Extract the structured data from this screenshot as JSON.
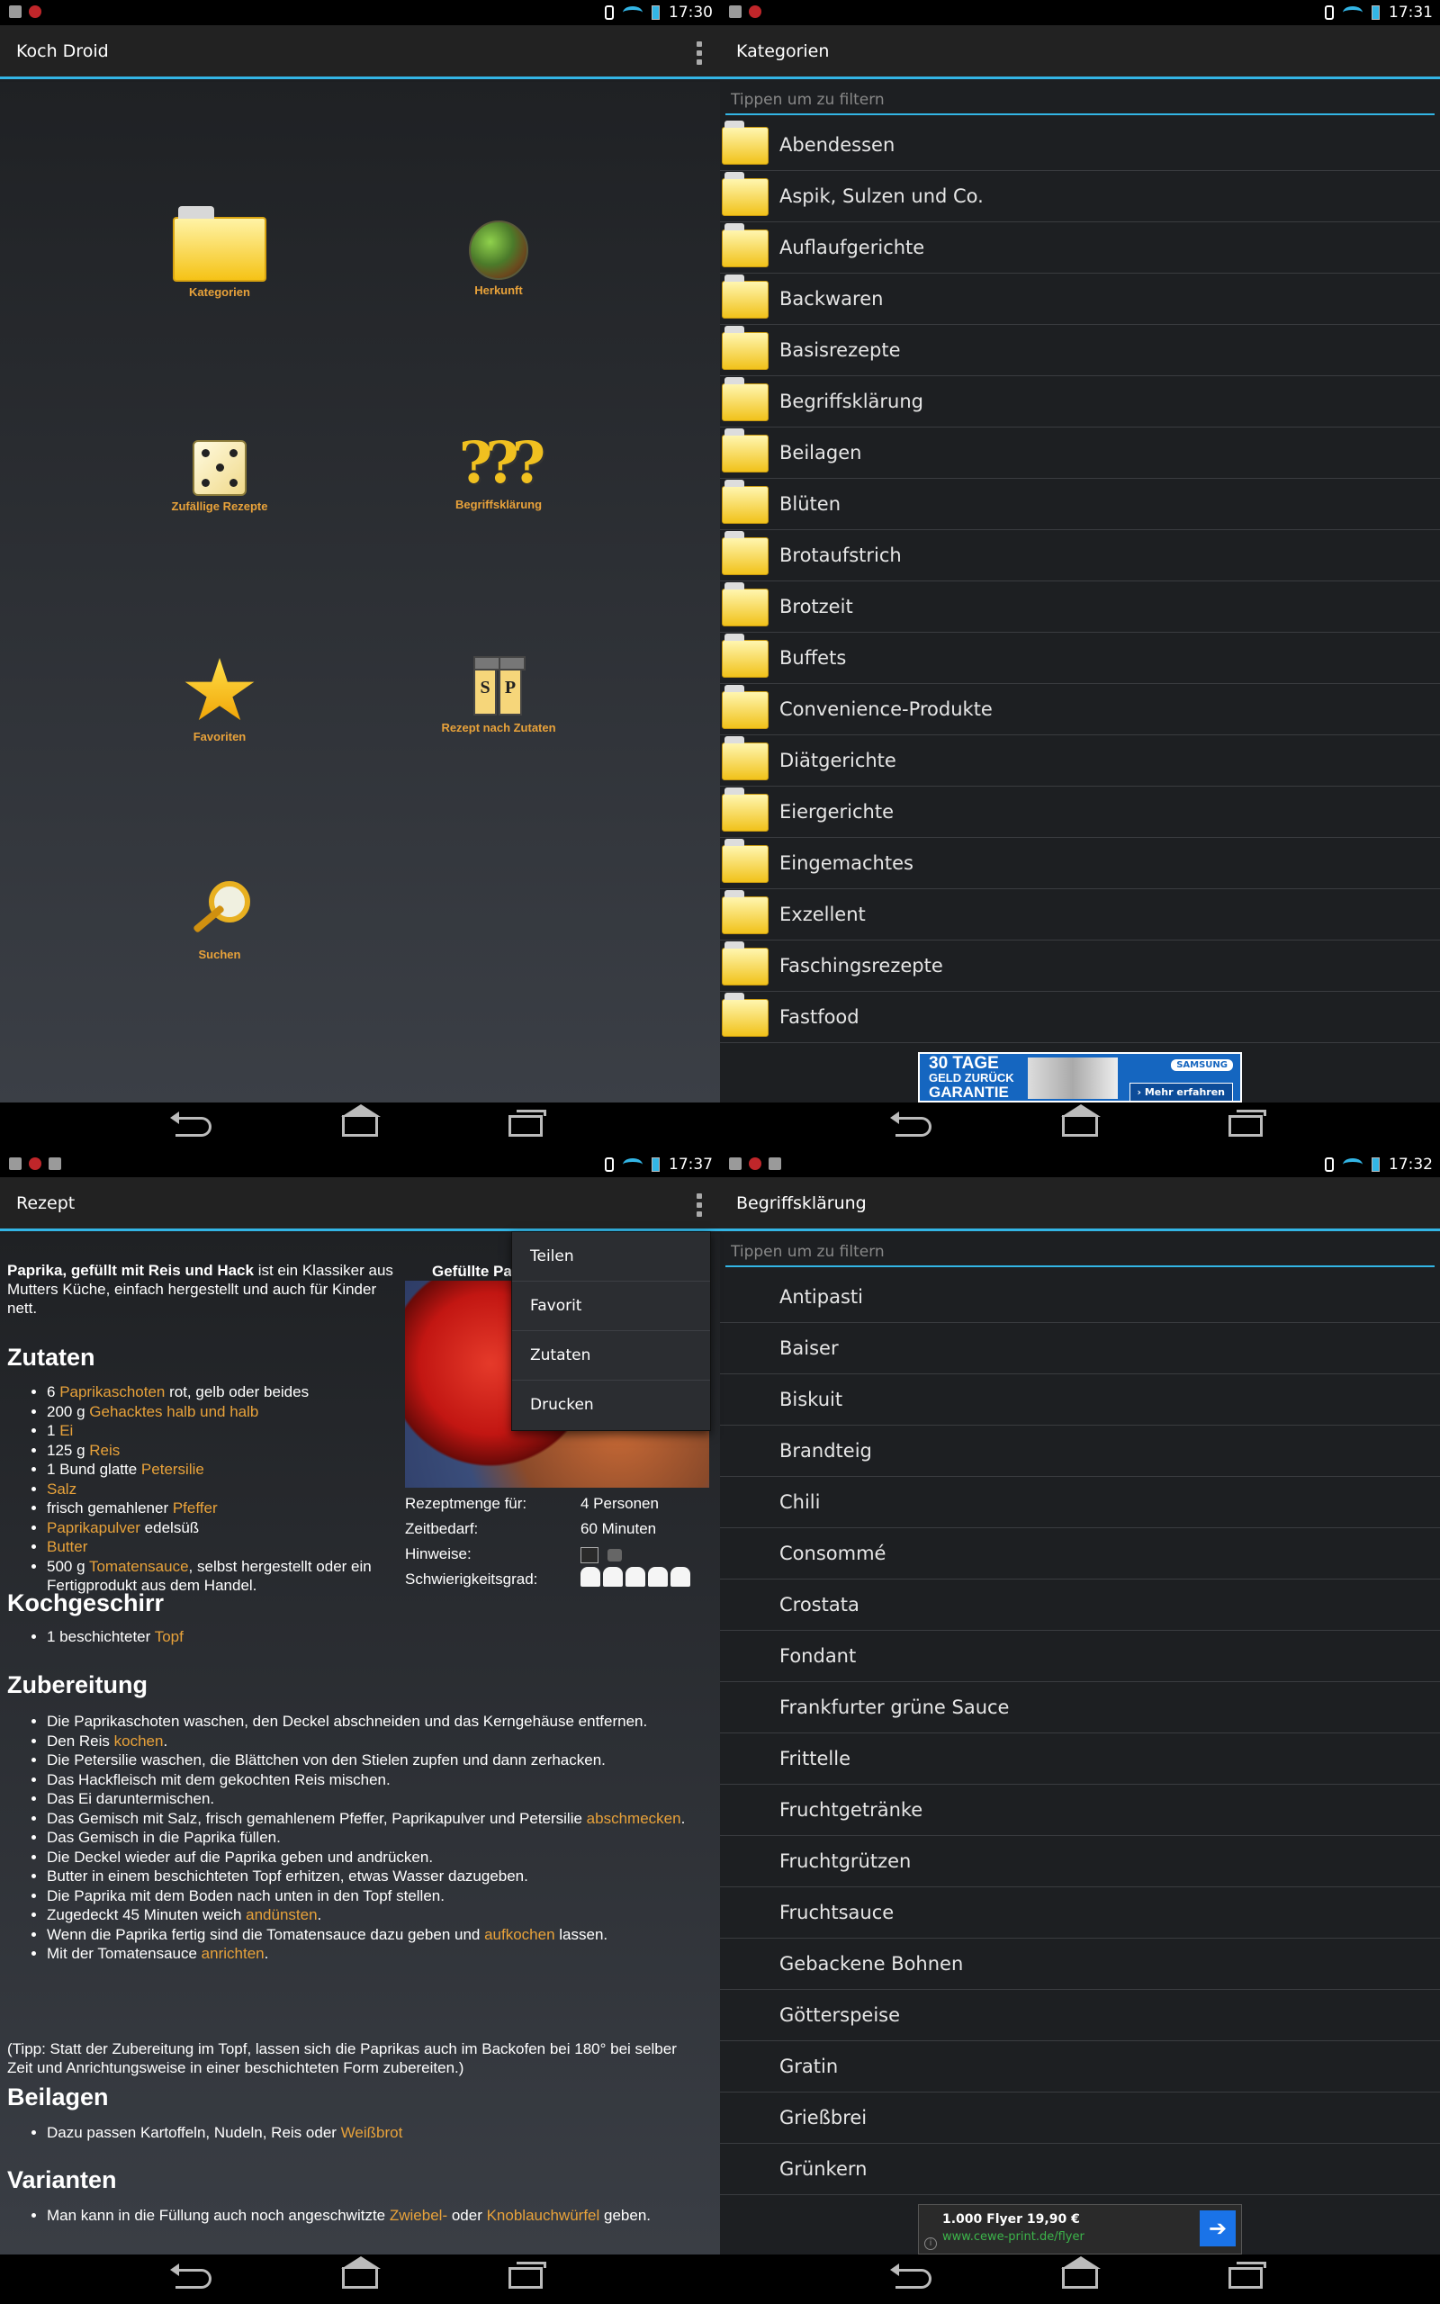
{
  "panel1": {
    "status_time": "17:30",
    "title": "Koch Droid",
    "tiles": [
      {
        "label": "Kategorien",
        "icon": "folder-icon"
      },
      {
        "label": "Herkunft",
        "icon": "globe-icon"
      },
      {
        "label": "Zufällige Rezepte",
        "icon": "dice-icon"
      },
      {
        "label": "Begriffsklärung",
        "icon": "question-marks-icon"
      },
      {
        "label": "Favoriten",
        "icon": "star-icon"
      },
      {
        "label": "Rezept nach Zutaten",
        "icon": "spice-shakers-icon"
      },
      {
        "label": "Suchen",
        "icon": "magnifier-icon"
      }
    ]
  },
  "panel2": {
    "status_time": "17:31",
    "title": "Kategorien",
    "filter_placeholder": "Tippen um zu filtern",
    "items": [
      "Abendessen",
      "Aspik, Sulzen und Co.",
      "Auflaufgerichte",
      "Backwaren",
      "Basisrezepte",
      "Begriffsklärung",
      "Beilagen",
      "Blüten",
      "Brotaufstrich",
      "Brotzeit",
      "Buffets",
      "Convenience-Produkte",
      "Diätgerichte",
      "Eiergerichte",
      "Eingemachtes",
      "Exzellent",
      "Faschingsrezepte",
      "Fastfood"
    ],
    "ad": {
      "line1": "30 TAGE",
      "line2": "GELD ZURÜCK",
      "line3": "GARANTIE",
      "brand": "SAMSUNG",
      "button": "› Mehr erfahren"
    }
  },
  "panel3": {
    "status_time": "17:37",
    "title": "Rezept",
    "intro_bold": "Paprika, gefüllt mit Reis und Hack",
    "intro_rest": " ist ein Klassiker aus Mutters Küche, einfach hergestellt und auch für Kinder nett.",
    "image_caption": "Gefüllte Pa",
    "meta": [
      {
        "key": "Rezeptmenge für:",
        "value": "4 Personen"
      },
      {
        "key": "Zeitbedarf:",
        "value": "60 Minuten"
      },
      {
        "key": "Hinweise:",
        "value": ""
      },
      {
        "key": "Schwierigkeitsgrad:",
        "value": ""
      }
    ],
    "headings": {
      "zutaten": "Zutaten",
      "kochgeschirr": "Kochgeschirr",
      "zubereitung": "Zubereitung",
      "beilagen": "Beilagen",
      "varianten": "Varianten"
    },
    "zutaten": [
      {
        "pre": "6 ",
        "link": "Paprikaschoten",
        "post": " rot, gelb oder beides"
      },
      {
        "pre": "200 g ",
        "link": "Gehacktes halb und halb",
        "post": ""
      },
      {
        "pre": "1 ",
        "link": "Ei",
        "post": ""
      },
      {
        "pre": "125 g ",
        "link": "Reis",
        "post": ""
      },
      {
        "pre": "1 Bund glatte ",
        "link": "Petersilie",
        "post": ""
      },
      {
        "pre": "",
        "link": "Salz",
        "post": ""
      },
      {
        "pre": "frisch gemahlener ",
        "link": "Pfeffer",
        "post": ""
      },
      {
        "pre": "",
        "link": "Paprikapulver",
        "post": " edelsüß"
      },
      {
        "pre": "",
        "link": "Butter",
        "post": ""
      },
      {
        "pre": "500 g ",
        "link": "Tomatensauce",
        "post": ", selbst hergestellt oder ein Fertigprodukt aus dem Handel."
      }
    ],
    "kochgeschirr": [
      {
        "pre": "1 beschichteter ",
        "link": "Topf",
        "post": ""
      }
    ],
    "zubereitung": [
      {
        "pre": "Die Paprikaschoten waschen, den Deckel abschneiden und das Kerngehäuse entfernen.",
        "link": "",
        "post": ""
      },
      {
        "pre": "Den Reis ",
        "link": "kochen",
        "post": "."
      },
      {
        "pre": "Die Petersilie waschen, die Blättchen von den Stielen zupfen und dann zerhacken.",
        "link": "",
        "post": ""
      },
      {
        "pre": "Das Hackfleisch mit dem gekochten Reis mischen.",
        "link": "",
        "post": ""
      },
      {
        "pre": "Das Ei daruntermischen.",
        "link": "",
        "post": ""
      },
      {
        "pre": "Das Gemisch mit Salz, frisch gemahlenem Pfeffer, Paprikapulver und Petersilie ",
        "link": "abschmecken",
        "post": "."
      },
      {
        "pre": "Das Gemisch in die Paprika füllen.",
        "link": "",
        "post": ""
      },
      {
        "pre": "Die Deckel wieder auf die Paprika geben und andrücken.",
        "link": "",
        "post": ""
      },
      {
        "pre": "Butter in einem beschichteten Topf erhitzen, etwas Wasser dazugeben.",
        "link": "",
        "post": ""
      },
      {
        "pre": "Die Paprika mit dem Boden nach unten in den Topf stellen.",
        "link": "",
        "post": ""
      },
      {
        "pre": "Zugedeckt 45 Minuten weich ",
        "link": "andünsten",
        "post": "."
      },
      {
        "pre": "Wenn die Paprika fertig sind die Tomatensauce dazu geben und ",
        "link": "aufkochen",
        "post": " lassen."
      },
      {
        "pre": "Mit der Tomatensauce ",
        "link": "anrichten",
        "post": "."
      }
    ],
    "tipp": "(Tipp: Statt der Zubereitung im Topf, lassen sich die Paprikas auch im Backofen bei 180° bei selber Zeit und Anrichtungsweise in einer beschichteten Form zubereiten.)",
    "beilagen": [
      {
        "pre": "Dazu passen Kartoffeln, Nudeln, Reis oder ",
        "link": "Weißbrot",
        "post": ""
      }
    ],
    "varianten": [
      {
        "pre": "Man kann in die Füllung auch noch angeschwitzte ",
        "link": "Zwiebel-",
        "post": " oder ",
        "link2": "Knoblauchwürfel",
        "post2": " geben."
      }
    ],
    "menu": [
      "Teilen",
      "Favorit",
      "Zutaten",
      "Drucken"
    ]
  },
  "panel4": {
    "status_time": "17:32",
    "title": "Begriffsklärung",
    "filter_placeholder": "Tippen um zu filtern",
    "items": [
      "Antipasti",
      "Baiser",
      "Biskuit",
      "Brandteig",
      "Chili",
      "Consommé",
      "Crostata",
      "Fondant",
      "Frankfurter grüne Sauce",
      "Frittelle",
      "Fruchtgetränke",
      "Fruchtgrützen",
      "Fruchtsauce",
      "Gebackene Bohnen",
      "Götterspeise",
      "Gratin",
      "Grießbrei",
      "Grünkern"
    ],
    "ad": {
      "line1": "1.000 Flyer 19,90 €",
      "line2": "www.cewe-print.de/flyer",
      "arrow": "➔",
      "info": "i"
    }
  },
  "colors": {
    "accent": "#33b5e5",
    "link": "#e8a23a",
    "background": "#1d1f22"
  }
}
